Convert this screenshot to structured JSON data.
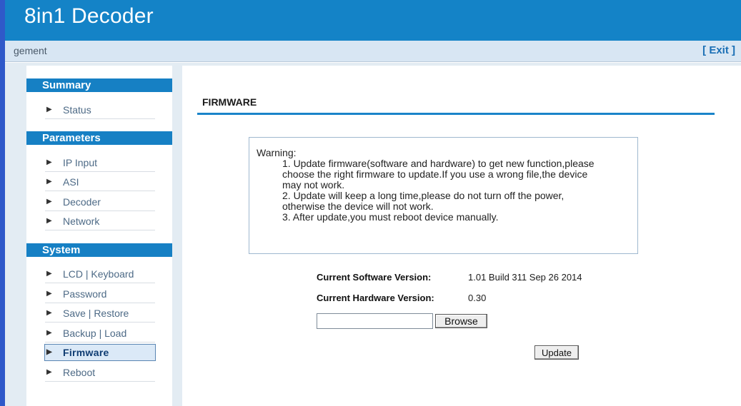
{
  "app": {
    "title": "8in1 Decoder",
    "breadcrumb": "gement",
    "exit_label": "[ Exit ]"
  },
  "sidebar": {
    "sections": [
      {
        "label": "Summary",
        "items": [
          {
            "label": "Status"
          }
        ]
      },
      {
        "label": "Parameters",
        "items": [
          {
            "label": "IP Input"
          },
          {
            "label": "ASI"
          },
          {
            "label": "Decoder"
          },
          {
            "label": "Network"
          }
        ]
      },
      {
        "label": "System",
        "items": [
          {
            "label": "LCD | Keyboard"
          },
          {
            "label": "Password"
          },
          {
            "label": "Save | Restore"
          },
          {
            "label": "Backup | Load"
          },
          {
            "label": "Firmware",
            "active": true
          },
          {
            "label": "Reboot"
          }
        ]
      }
    ]
  },
  "main": {
    "title": "FIRMWARE",
    "warning": {
      "heading": "Warning:",
      "lines": [
        "1. Update firmware(software and hardware) to get new function,please",
        "choose the right firmware to update.If you use a wrong file,the device",
        "may not work.",
        "2. Update will keep a long time,please do not turn off the power,",
        "otherwise the device will not work.",
        "3. After update,you must reboot device manually."
      ]
    },
    "software_version": {
      "label": "Current Software Version:",
      "value": "1.01 Build 311 Sep 26 2014"
    },
    "hardware_version": {
      "label": "Current Hardware Version:",
      "value": "0.30"
    },
    "file_input": {
      "value": ""
    },
    "browse_label": "Browse",
    "update_label": "Update"
  },
  "colors": {
    "header": "#1483c7",
    "section_header": "#1680c4",
    "title_rule": "#1a84c9",
    "left_edge": "#2f59c9"
  },
  "icons": {
    "nav_arrow": "triangle-right-icon"
  }
}
